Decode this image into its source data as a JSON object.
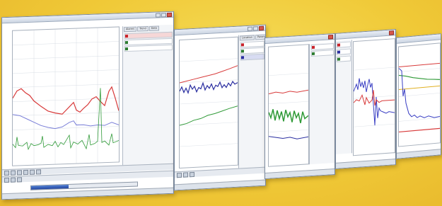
{
  "windows": [
    {
      "id": "w1",
      "tabs": [
        "Alarms",
        "Trend",
        "Data"
      ],
      "legend": [
        {
          "label": "",
          "color": "#c9232a"
        },
        {
          "label": "",
          "color": "#2e7d32"
        },
        {
          "label": "",
          "color": "#2e7d32"
        }
      ],
      "progress": 0.35
    },
    {
      "id": "w2",
      "tabs": [
        "Location",
        "Parameter"
      ],
      "legend": [
        {
          "label": "",
          "color": "#c9232a"
        },
        {
          "label": "",
          "color": "#2e7d32"
        },
        {
          "label": "",
          "color": "#2a2ea0"
        }
      ]
    },
    {
      "id": "w3",
      "legend": [
        {
          "label": "",
          "color": "#c9232a"
        },
        {
          "label": "",
          "color": "#2e7d32"
        }
      ]
    }
  ],
  "colors": {
    "background": "#f0c937",
    "series_red": "#d83a3a",
    "series_blue": "#3a3fc4",
    "series_green": "#2f9a37",
    "series_orange": "#e08a20"
  }
}
